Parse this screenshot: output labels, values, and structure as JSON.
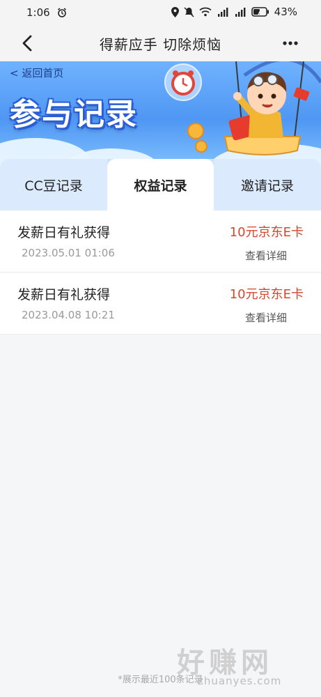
{
  "status": {
    "time": "1:06",
    "battery": "43%"
  },
  "nav": {
    "title": "得薪应手 切除烦恼"
  },
  "banner": {
    "back_home": "< 返回首页",
    "title": "参与记录"
  },
  "tabs": [
    {
      "label": "CC豆记录",
      "active": false
    },
    {
      "label": "权益记录",
      "active": true
    },
    {
      "label": "邀请记录",
      "active": false
    }
  ],
  "records": [
    {
      "title": "发薪日有礼获得",
      "date": "2023.05.01 01:06",
      "reward": "10元京东E卡",
      "detail_label": "查看详细"
    },
    {
      "title": "发薪日有礼获得",
      "date": "2023.04.08 10:21",
      "reward": "10元京东E卡",
      "detail_label": "查看详细"
    }
  ],
  "footer": {
    "note": "*展示最近100条记录"
  },
  "watermark": {
    "big": "好赚网",
    "small": "zhuanyes.com"
  },
  "colors": {
    "reward": "#d1482b",
    "banner_blue": "#4f97f3",
    "tab_active_bg": "#ffffff",
    "tab_inactive_bg": "#dbeafc"
  },
  "icons": {
    "back": "chevron-left-icon",
    "more": "more-dots-icon",
    "alarm": "alarm-clock-icon"
  }
}
